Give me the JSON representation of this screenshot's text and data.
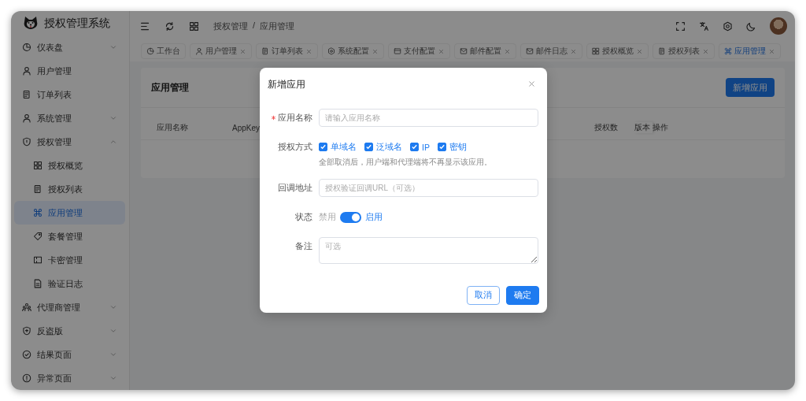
{
  "sidebar": {
    "title": "授权管理系统",
    "items": [
      {
        "label": "仪表盘",
        "expanded": false
      },
      {
        "label": "用户管理",
        "selected": false
      },
      {
        "label": "订单列表",
        "selected": false
      },
      {
        "label": "系统管理",
        "expanded": false
      },
      {
        "label": "授权管理",
        "expanded": true,
        "children": [
          {
            "label": "授权概览",
            "selected": false
          },
          {
            "label": "授权列表",
            "selected": false
          },
          {
            "label": "应用管理",
            "selected": true
          },
          {
            "label": "套餐管理",
            "selected": false
          },
          {
            "label": "卡密管理",
            "selected": false
          },
          {
            "label": "验证日志",
            "selected": false
          }
        ]
      },
      {
        "label": "代理商管理",
        "expanded": false
      },
      {
        "label": "反盗版",
        "expanded": false
      },
      {
        "label": "结果页面",
        "expanded": false
      },
      {
        "label": "异常页面",
        "expanded": false
      }
    ]
  },
  "header": {
    "breadcrumb": [
      "授权管理",
      "应用管理"
    ],
    "separator": "/"
  },
  "tabs": [
    {
      "label": "工作台",
      "closable": false,
      "selected": false
    },
    {
      "label": "用户管理",
      "closable": true,
      "selected": false
    },
    {
      "label": "订单列表",
      "closable": true,
      "selected": false
    },
    {
      "label": "系统配置",
      "closable": true,
      "selected": false
    },
    {
      "label": "支付配置",
      "closable": true,
      "selected": false
    },
    {
      "label": "邮件配置",
      "closable": true,
      "selected": false
    },
    {
      "label": "邮件日志",
      "closable": true,
      "selected": false
    },
    {
      "label": "授权概览",
      "closable": true,
      "selected": false
    },
    {
      "label": "授权列表",
      "closable": true,
      "selected": false
    },
    {
      "label": "应用管理",
      "closable": true,
      "selected": true
    }
  ],
  "card": {
    "title": "应用管理",
    "button": "新增应用",
    "columns": [
      "应用名称",
      "AppKey",
      "授权数",
      "版本",
      "操作"
    ]
  },
  "dialog": {
    "title": "新增应用",
    "fields": [
      {
        "kind": "input",
        "label": "应用名称",
        "required": true,
        "placeholder": "请输入应用名称"
      },
      {
        "kind": "checkboxes",
        "label": "授权方式",
        "options": [
          {
            "label": "单域名",
            "checked": true
          },
          {
            "label": "泛域名",
            "checked": true
          },
          {
            "label": "IP",
            "checked": true
          },
          {
            "label": "密钥",
            "checked": true
          }
        ],
        "hint": "全部取消后，用户端和代理端将不再显示该应用。"
      },
      {
        "kind": "input",
        "label": "回调地址",
        "required": false,
        "placeholder": "授权验证回调URL（可选）"
      },
      {
        "kind": "switch",
        "label": "状态",
        "off_label": "禁用",
        "on_label": "启用",
        "on": true
      },
      {
        "kind": "textarea",
        "label": "备注",
        "placeholder": "可选"
      }
    ],
    "buttons": [
      {
        "label": "取消",
        "kind": "secondary"
      },
      {
        "label": "确定",
        "kind": "primary"
      }
    ]
  }
}
